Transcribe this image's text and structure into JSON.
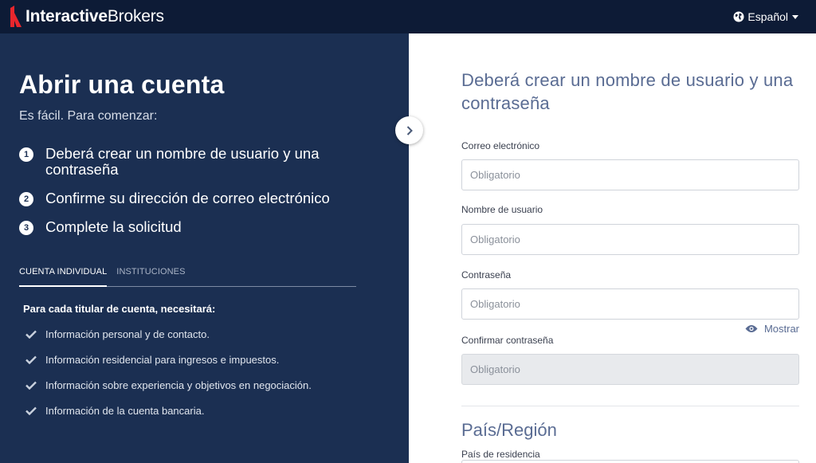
{
  "header": {
    "brand_bold": "Interactive",
    "brand_light": "Brokers",
    "language": "Español",
    "logo_color": "#e8262d"
  },
  "left": {
    "title": "Abrir una cuenta",
    "subtitle": "Es fácil. Para comenzar:",
    "steps": [
      {
        "num": "1",
        "text": "Deberá crear un nombre de usuario y una contraseña"
      },
      {
        "num": "2",
        "text": "Confirme su dirección de correo electrónico"
      },
      {
        "num": "3",
        "text": "Complete la solicitud"
      }
    ],
    "tabs": [
      {
        "label": "CUENTA INDIVIDUAL",
        "active": true
      },
      {
        "label": "INSTITUCIONES",
        "active": false
      }
    ],
    "needs_title": "Para cada titular de cuenta, necesitará:",
    "needs": [
      "Información personal y de contacto.",
      "Información residencial para ingresos e impuestos.",
      "Información sobre experiencia y objetivos en negociación.",
      "Información de la cuenta bancaria."
    ]
  },
  "form": {
    "title": "Deberá crear un nombre de usuario y una contraseña",
    "email_label": "Correo electrónico",
    "email_placeholder": "Obligatorio",
    "username_label": "Nombre de usuario",
    "username_placeholder": "Obligatorio",
    "password_label": "Contraseña",
    "password_placeholder": "Obligatorio",
    "show_label": "Mostrar",
    "confirm_label": "Confirmar contraseña",
    "confirm_placeholder": "Obligatorio",
    "country_title": "País/Región",
    "residence_label": "País de residencia"
  }
}
